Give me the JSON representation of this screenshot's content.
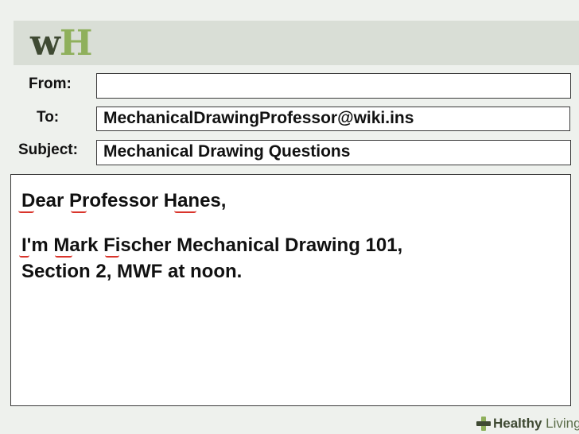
{
  "logo": {
    "part1": "w",
    "part2": "H"
  },
  "form": {
    "from": {
      "label": "From:",
      "value": ""
    },
    "to": {
      "label": "To:",
      "value": "MechanicalDrawingProfessor@wiki.ins"
    },
    "subject": {
      "label": "Subject:",
      "value": "Mechanical Drawing Questions"
    }
  },
  "message": {
    "greeting": "Dear Professor Hanes,",
    "line1": "I'm Mark Fischer Mechanical Drawing 101,",
    "line2": "Section 2, MWF at noon."
  },
  "footer": {
    "brand_bold": "Healthy",
    "brand_light": " Living"
  },
  "colors": {
    "logo_dark": "#3f4a33",
    "logo_green": "#8fb05c",
    "highlight_underline": "#d9342b",
    "header_band": "#d9ded6"
  }
}
